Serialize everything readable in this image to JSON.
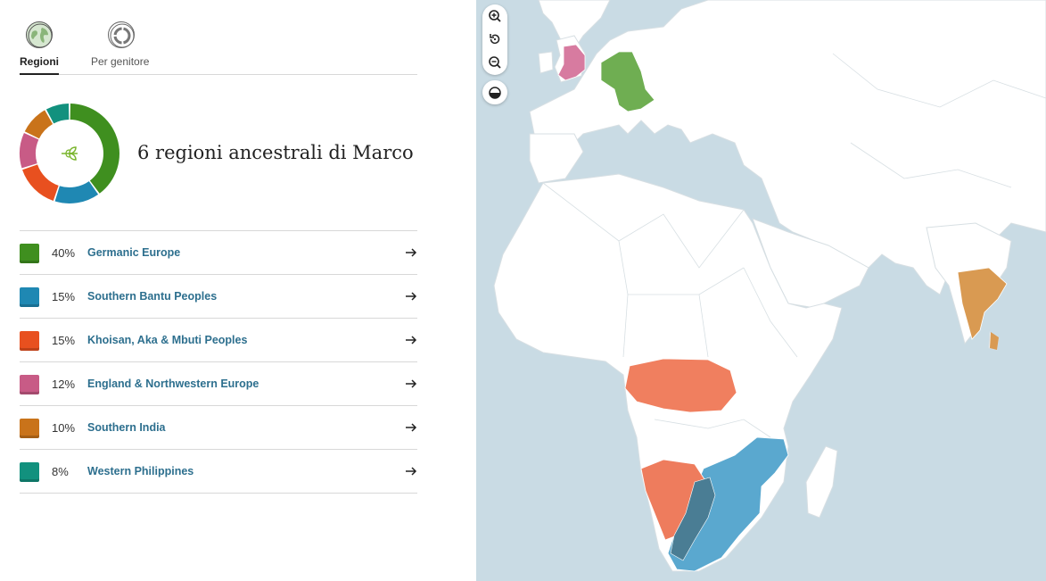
{
  "tabs": [
    {
      "label": "Regioni",
      "active": true,
      "icon": "globe-icon"
    },
    {
      "label": "Per genitore",
      "active": false,
      "icon": "parents-circle-icon"
    }
  ],
  "heading": "6 regioni ancestrali di Marco",
  "center_icon": "leaf-sprout-icon",
  "regions": [
    {
      "percent": "40%",
      "name": "Germanic Europe",
      "color": "#3f8f1f",
      "value": 40
    },
    {
      "percent": "15%",
      "name": "Southern Bantu Peoples",
      "color": "#1f88b3",
      "value": 15
    },
    {
      "percent": "15%",
      "name": "Khoisan, Aka & Mbuti Peoples",
      "color": "#e8501f",
      "value": 15
    },
    {
      "percent": "12%",
      "name": "England & Northwestern Europe",
      "color": "#c85b86",
      "value": 12
    },
    {
      "percent": "10%",
      "name": "Southern India",
      "color": "#c9731a",
      "value": 10
    },
    {
      "percent": "8%",
      "name": "Western Philippines",
      "color": "#12917e",
      "value": 8
    }
  ],
  "map": {
    "controls": [
      "zoom-in-icon",
      "reset-view-icon",
      "zoom-out-icon",
      "contrast-toggle-icon"
    ],
    "colors": {
      "water": "#c9dbe4",
      "land": "#ffffff",
      "germanic": "#6fae52",
      "england": "#d77ba0",
      "india": "#d99a52",
      "khoisan_central": "#f07f5f",
      "khoisan_south": "#ee7c5d",
      "bantu": "#5aa8cf",
      "overlap": "#4a7d94"
    }
  },
  "arrow_icon": "arrow-right-icon"
}
